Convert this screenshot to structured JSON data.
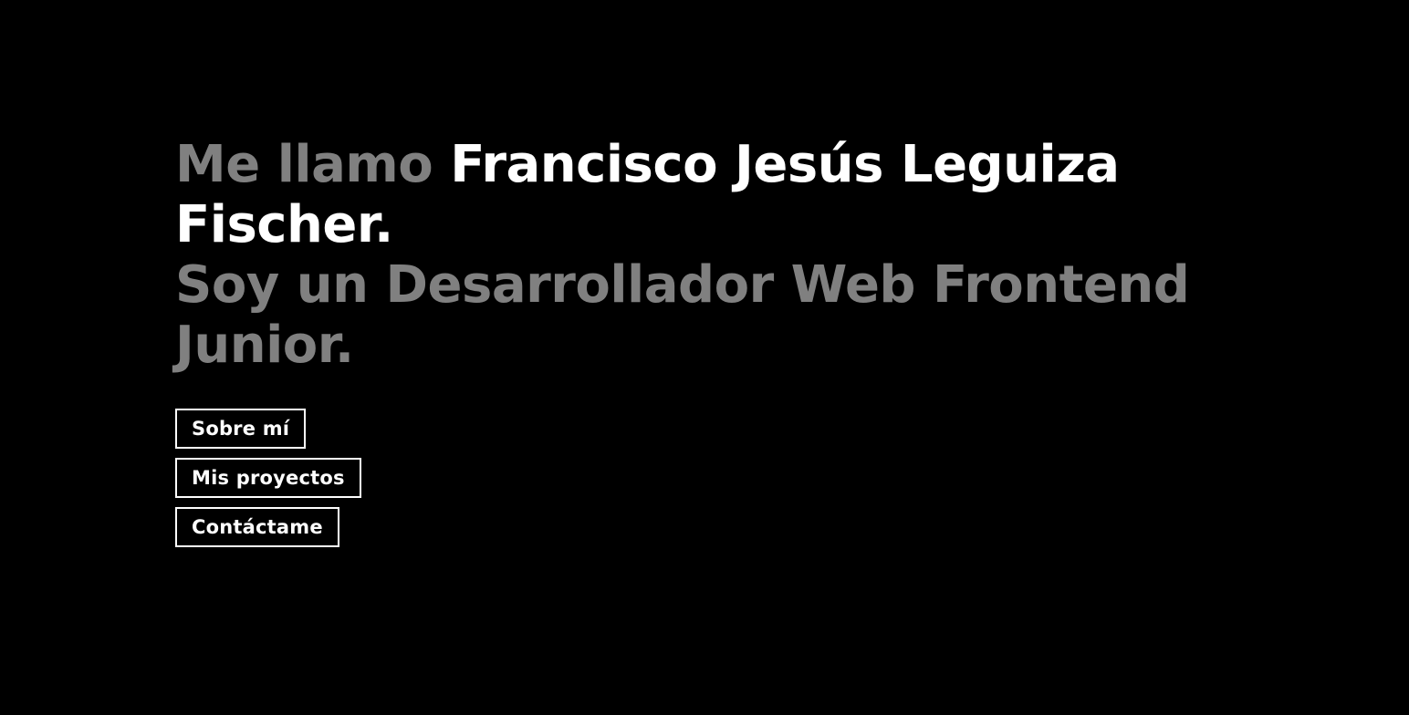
{
  "hero": {
    "intro": "Me llamo",
    "name": "Francisco Jesús Leguiza Fischer.",
    "role": "Soy un Desarrollador Web Frontend Junior."
  },
  "nav": {
    "about_label": "Sobre mí",
    "projects_label": "Mis proyectos",
    "contact_label": "Contáctame"
  },
  "colors": {
    "background": "#000000",
    "primary_text": "#ffffff",
    "muted_text": "#808080"
  }
}
